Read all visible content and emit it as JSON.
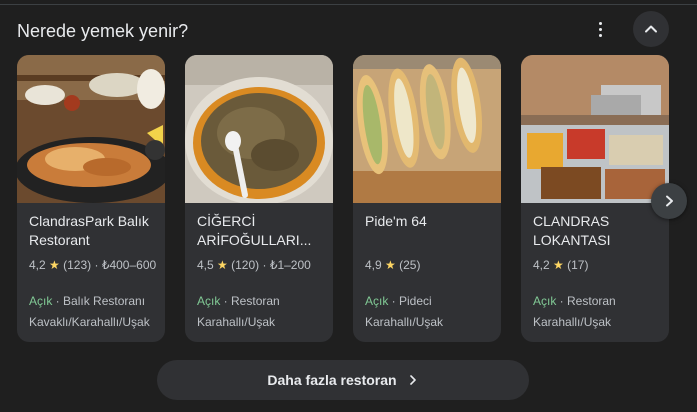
{
  "header": {
    "title": "Nerede yemek yenir?"
  },
  "icons": {
    "more": "more-vert-icon",
    "collapse": "chevron-up-icon",
    "next": "chevron-right-icon",
    "star": "star-icon"
  },
  "colors": {
    "open_status": "#81c995",
    "star": "#fdd663",
    "card_bg": "#303134",
    "page_bg": "#1f1f1f"
  },
  "cards": [
    {
      "name": "ClandrasPark Balık Restorant",
      "rating": "4,2",
      "reviews": "(123)",
      "price": "₺400–600",
      "status": "Açık",
      "category": "Balık Restoranı",
      "location": "Kavaklı/Karahallı/Uşak"
    },
    {
      "name": "CİĞERCİ ARİFOĞULLARI...",
      "rating": "4,5",
      "reviews": "(120)",
      "price": "₺1–200",
      "status": "Açık",
      "category": "Restoran",
      "location": "Karahallı/Uşak"
    },
    {
      "name": "Pide'm 64",
      "rating": "4,9",
      "reviews": "(25)",
      "price": "",
      "status": "Açık",
      "category": "Pideci",
      "location": "Karahallı/Uşak"
    },
    {
      "name": "CLANDRAS LOKANTASI",
      "rating": "4,2",
      "reviews": "(17)",
      "price": "",
      "status": "Açık",
      "category": "Restoran",
      "location": "Karahallı/Uşak"
    }
  ],
  "footer": {
    "more_label": "Daha fazla restoran"
  }
}
